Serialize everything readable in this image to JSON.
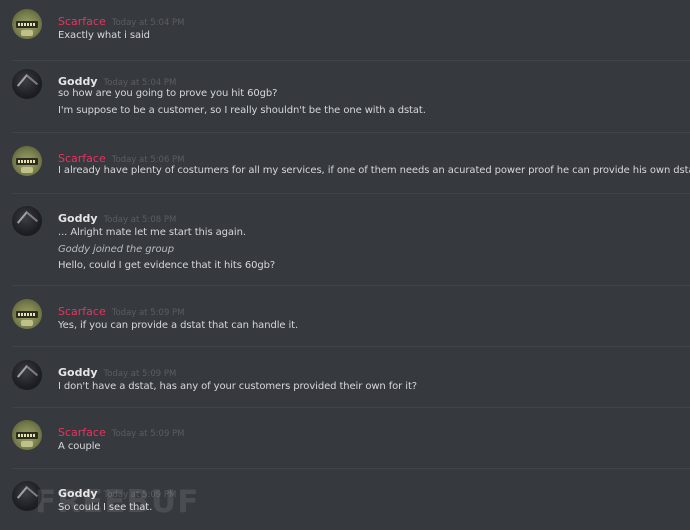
{
  "messages": [
    {
      "user": "Scarface",
      "avatar": "scarface-avatar",
      "time": "Today at 5:04 PM",
      "lines": [
        {
          "text": "Exactly what i said",
          "italic": false
        }
      ]
    },
    {
      "user": "Goddy",
      "avatar": "goddy-avatar",
      "time": "Today at 5:04 PM",
      "lines": [
        {
          "text": "so how are you going to prove you hit 60gb?",
          "italic": false
        },
        {
          "text": "I'm suppose to be a customer, so I really shouldn't be the one with a dstat.",
          "italic": false
        }
      ]
    },
    {
      "user": "Scarface",
      "avatar": "scarface-avatar",
      "time": "Today at 5:06 PM",
      "lines": [
        {
          "text": "I already have plenty of costumers for all my services, if one of them needs an acurated power proof he can provide his own dstat",
          "italic": false
        }
      ]
    },
    {
      "user": "Goddy",
      "avatar": "goddy-avatar",
      "time": "Today at 5:08 PM",
      "lines": [
        {
          "text": "... Alright mate let me start this again.",
          "italic": false
        },
        {
          "text": "Goddy joined the group",
          "italic": true
        },
        {
          "text": "Hello, could I get evidence that it hits 60gb?",
          "italic": false
        }
      ]
    },
    {
      "user": "Scarface",
      "avatar": "scarface-avatar",
      "time": "Today at 5:09 PM",
      "lines": [
        {
          "text": "Yes, if you can provide a dstat that can handle it.",
          "italic": false
        }
      ]
    },
    {
      "user": "Goddy",
      "avatar": "goddy-avatar",
      "time": "Today at 5:09 PM",
      "lines": [
        {
          "text": "I don't have a dstat, has any of your customers provided their own for it?",
          "italic": false
        }
      ]
    },
    {
      "user": "Scarface",
      "avatar": "scarface-avatar",
      "time": "Today at 5:09 PM",
      "lines": [
        {
          "text": "A couple",
          "italic": false
        }
      ]
    },
    {
      "user": "Goddy",
      "avatar": "goddy-avatar",
      "time": "Today at 5:09 PM",
      "lines": [
        {
          "text": "So could I see that.",
          "italic": false
        }
      ]
    }
  ],
  "watermark": "FREEBUF",
  "colors": {
    "background": "#36393e",
    "scarface": "#e8345f",
    "goddy": "#e6e6e6",
    "timestamp": "#5a5d63",
    "text": "#d6d7d9"
  }
}
